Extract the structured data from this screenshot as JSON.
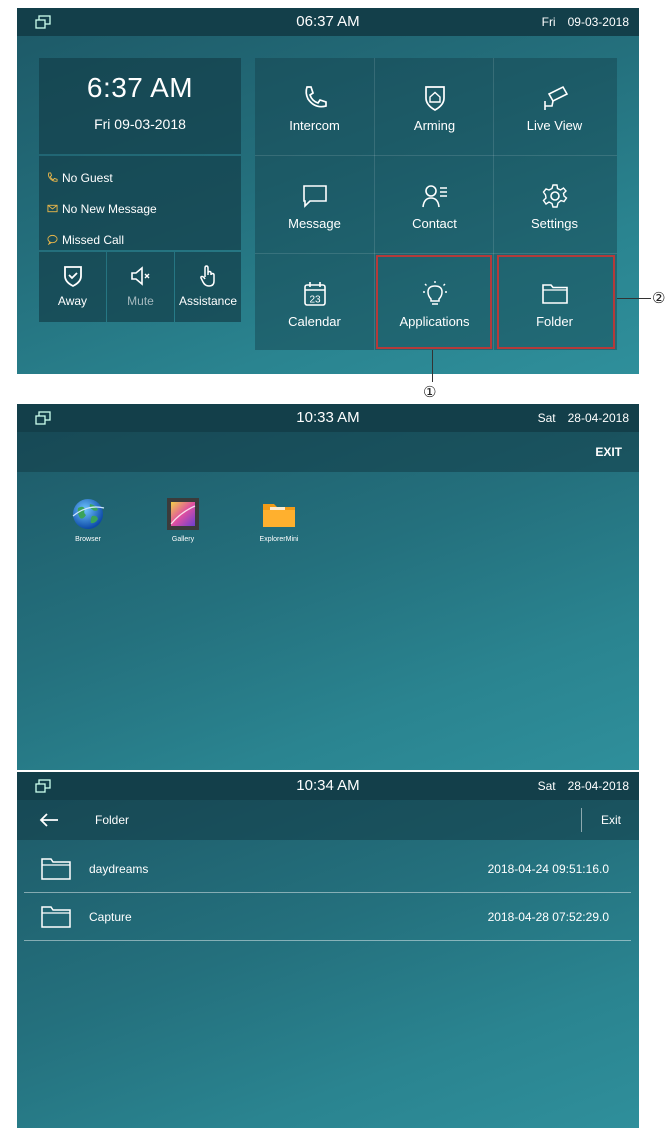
{
  "screen1": {
    "status": {
      "time": "06:37 AM",
      "day": "Fri",
      "date": "09-03-2018"
    },
    "clock": {
      "time": "6:37 AM",
      "date": "Fri 09-03-2018"
    },
    "info": [
      "No Guest",
      "No New Message",
      "Missed Call"
    ],
    "quick": [
      "Away",
      "Mute",
      "Assistance"
    ],
    "tiles": [
      "Intercom",
      "Arming",
      "Live View",
      "Message",
      "Contact",
      "Settings",
      "Calendar",
      "Applications",
      "Folder"
    ],
    "calendar_day": "23",
    "callouts": {
      "one": "①",
      "two": "②"
    },
    "colors": {
      "highlight": "#b43a3a",
      "phone_icon": "#e8b64a"
    }
  },
  "screen2": {
    "status": {
      "time": "10:33 AM",
      "day": "Sat",
      "date": "28-04-2018"
    },
    "exit": "EXIT",
    "apps": [
      "Browser",
      "Gallery",
      "ExplorerMini"
    ]
  },
  "screen3": {
    "status": {
      "time": "10:34 AM",
      "day": "Sat",
      "date": "28-04-2018"
    },
    "title": "Folder",
    "exit": "Exit",
    "folders": [
      {
        "name": "daydreams",
        "date": "2018-04-24 09:51:16.0"
      },
      {
        "name": "Capture",
        "date": "2018-04-28 07:52:29.0"
      }
    ]
  }
}
